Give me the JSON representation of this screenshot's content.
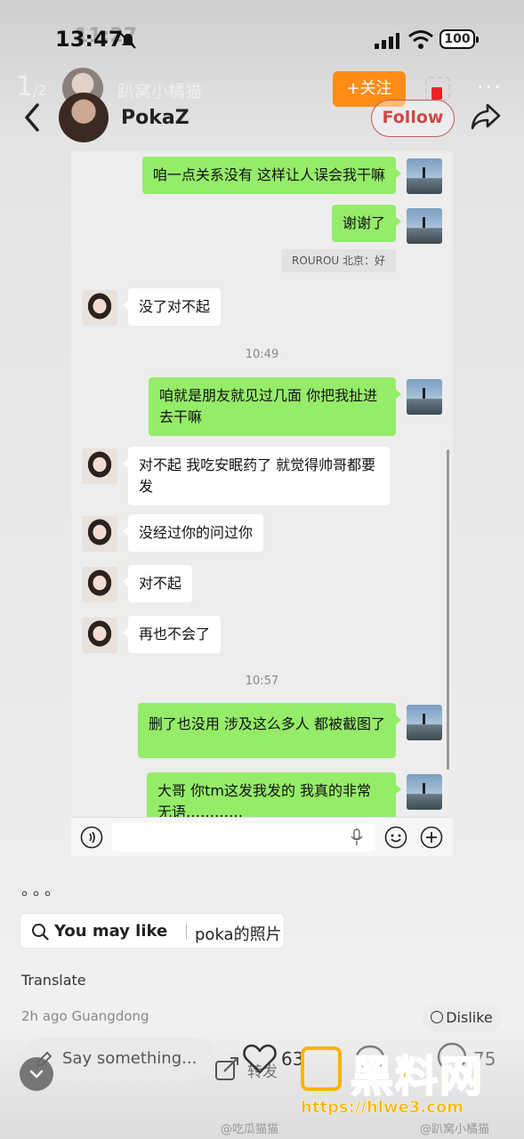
{
  "status_bar": {
    "time": "13:47",
    "time_ghost": "11:27",
    "battery": "100"
  },
  "ghost_header": {
    "page_indicator": "1",
    "page_total": "/2",
    "name": "趴窝小橘猫",
    "follow_label": "+关注",
    "more": "···"
  },
  "header": {
    "user_name": "PokaZ",
    "follow_label": "Follow"
  },
  "chat": {
    "messages": [
      {
        "text": "咱一点关系没有 这样让人误会我干嘛"
      },
      {
        "text": "谢谢了"
      },
      {
        "text": "ROUROU 北京：好"
      },
      {
        "text": "没了对不起"
      },
      {
        "text": "咱就是朋友就见过几面 你把我扯进去干嘛"
      },
      {
        "text": "对不起 我吃安眠药了 就觉得帅哥都要发"
      },
      {
        "text": "没经过你的问过你"
      },
      {
        "text": "对不起"
      },
      {
        "text": "再也不会了"
      },
      {
        "text": "删了也没用 涉及这么多人 都被截图了"
      },
      {
        "text": "大哥 你tm这发我发的 我真的非常无语…………"
      }
    ],
    "timestamps": [
      "10:49",
      "10:57"
    ]
  },
  "post": {
    "caption": "。。。",
    "may_like_label": "You may like",
    "may_like_query": "poka的照片",
    "translate": "Translate",
    "meta": "2h ago Guangdong",
    "dislike": "Dislike"
  },
  "bottom_bar": {
    "say_placeholder": "Say something...",
    "repost_label": "转发",
    "like_count": "63",
    "star_count": "75"
  },
  "watermarks": {
    "logo_text": "黑料网",
    "url": "https://hlwe3.com",
    "left": "@吃瓜猫猫",
    "right": "@趴窝小橘猫"
  },
  "icons": [
    "bell-icon",
    "signal-icon",
    "wifi-icon",
    "back-icon",
    "share-icon",
    "voice-icon",
    "mic-icon",
    "emoji-icon",
    "plus-icon",
    "search-icon",
    "pencil-icon",
    "repost-icon",
    "like-icon",
    "comment-icon",
    "star-icon",
    "chevron-down-icon"
  ],
  "colors": {
    "follow_ghost": "#ff8c16",
    "follow_red": "#d04848",
    "bubble_green": "#95ec69",
    "watermark_yellow": "#f7b500"
  }
}
